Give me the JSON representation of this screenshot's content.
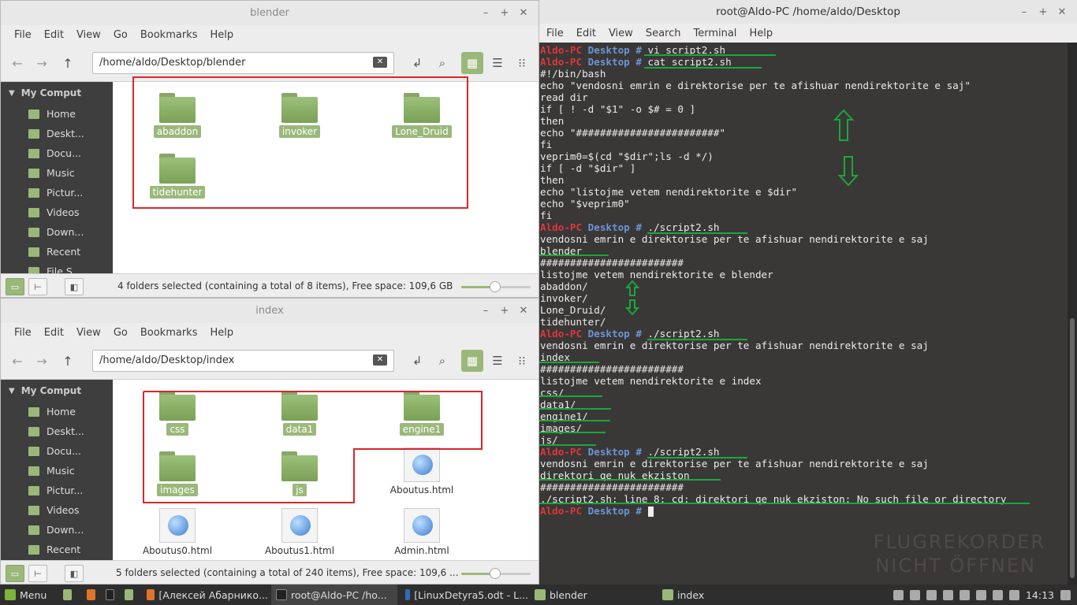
{
  "fm1": {
    "title": "blender",
    "menu": [
      "File",
      "Edit",
      "View",
      "Go",
      "Bookmarks",
      "Help"
    ],
    "path": "/home/aldo/Desktop/blender",
    "sidebar_head": "My Comput",
    "sidebar": [
      "Home",
      "Deskt...",
      "Docu...",
      "Music",
      "Pictur...",
      "Videos",
      "Down...",
      "Recent",
      "File S"
    ],
    "items": [
      "abaddon",
      "invoker",
      "Lone_Druid",
      "tidehunter"
    ],
    "status": "4 folders selected (containing a total of 8 items), Free space: 109,6 GB"
  },
  "fm2": {
    "title": "index",
    "menu": [
      "File",
      "Edit",
      "View",
      "Go",
      "Bookmarks",
      "Help"
    ],
    "path": "/home/aldo/Desktop/index",
    "sidebar_head": "My Comput",
    "sidebar": [
      "Home",
      "Deskt...",
      "Docu...",
      "Music",
      "Pictur...",
      "Videos",
      "Down...",
      "Recent"
    ],
    "folders": [
      "css",
      "data1",
      "engine1",
      "images",
      "js"
    ],
    "files": [
      "Aboutus.html",
      "Aboutus0.html",
      "Aboutus1.html",
      "Admin.html"
    ],
    "status": "5 folders selected (containing a total of 240 items), Free space: 109,6 ..."
  },
  "terminal": {
    "title": "root@Aldo-PC /home/aldo/Desktop",
    "menu": [
      "File",
      "Edit",
      "View",
      "Search",
      "Terminal",
      "Help"
    ],
    "prompt_host": "Aldo-PC",
    "prompt_dir": "Desktop #",
    "lines": [
      {
        "p": true,
        "t": " vi script2.sh"
      },
      {
        "p": true,
        "t": " cat script2.sh"
      },
      {
        "t": "#!/bin/bash"
      },
      {
        "t": "echo \"vendosni emrin e direktorise per te afishuar nendirektorite e saj\""
      },
      {
        "t": "read dir"
      },
      {
        "t": "if [ ! -d \"$1\" -o $# = 0 ]"
      },
      {
        "t": "then"
      },
      {
        "t": "echo \"########################\""
      },
      {
        "t": "fi"
      },
      {
        "t": "veprim0=$(cd \"$dir\";ls -d */)"
      },
      {
        "t": "if [ -d \"$dir\" ]"
      },
      {
        "t": "then"
      },
      {
        "t": "echo \"listojme vetem nendirektorite e $dir\""
      },
      {
        "t": "echo \"$veprim0\""
      },
      {
        "t": "fi"
      },
      {
        "p": true,
        "t": " ./script2.sh"
      },
      {
        "t": "vendosni emrin e direktorise per te afishuar nendirektorite e saj"
      },
      {
        "t": "blender"
      },
      {
        "t": "########################"
      },
      {
        "t": "listojme vetem nendirektorite e blender"
      },
      {
        "t": "abaddon/"
      },
      {
        "t": "invoker/"
      },
      {
        "t": "Lone_Druid/"
      },
      {
        "t": "tidehunter/"
      },
      {
        "p": true,
        "t": " ./script2.sh"
      },
      {
        "t": "vendosni emrin e direktorise per te afishuar nendirektorite e saj"
      },
      {
        "t": "index"
      },
      {
        "t": "########################"
      },
      {
        "t": "listojme vetem nendirektorite e index"
      },
      {
        "t": "css/"
      },
      {
        "t": "data1/"
      },
      {
        "t": "engine1/"
      },
      {
        "t": "images/"
      },
      {
        "t": "js/"
      },
      {
        "p": true,
        "t": " ./script2.sh"
      },
      {
        "t": "vendosni emrin e direktorise per te afishuar nendirektorite e saj"
      },
      {
        "t": "direktori qe nuk ekziston"
      },
      {
        "t": "########################"
      },
      {
        "t": "./script2.sh: line 8: cd: direktori qe nuk ekziston: No such file or directory"
      },
      {
        "p": true,
        "t": " ",
        "cursor": true
      }
    ],
    "watermark": [
      "FLUGREKORDER",
      "NICHT ÖFFNEN"
    ]
  },
  "taskbar": {
    "menu": "Menu",
    "items": [
      "[Алексей Абарнико...",
      "root@Aldo-PC /ho...",
      "[LinuxDetyra5.odt - L...",
      "blender",
      "index"
    ],
    "clock": "14:13"
  },
  "colors": {
    "accent": "#9ab87a",
    "annot_red": "#d9262c",
    "annot_green": "#19a83a",
    "prompt_red": "#e0353a",
    "prompt_blue": "#6c95d6"
  }
}
